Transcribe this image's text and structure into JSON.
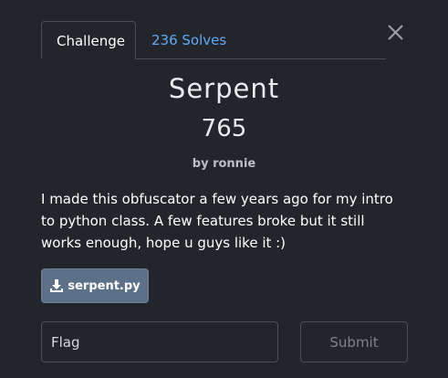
{
  "tabs": {
    "challenge_label": "Challenge",
    "solves_label": "236 Solves"
  },
  "challenge": {
    "title": "Serpent",
    "points": "765",
    "author": "by ronnie",
    "description": "I made this obfuscator a few years ago for my intro to python class. A few features broke but it still works enough, hope u guys like it :)"
  },
  "file": {
    "label": "serpent.py",
    "icon": "download-icon"
  },
  "form": {
    "flag_placeholder": "Flag",
    "flag_value": "",
    "submit_label": "Submit"
  },
  "colors": {
    "background": "#22262b",
    "accent_link": "#62a9f5",
    "file_button": "#5c7088"
  }
}
